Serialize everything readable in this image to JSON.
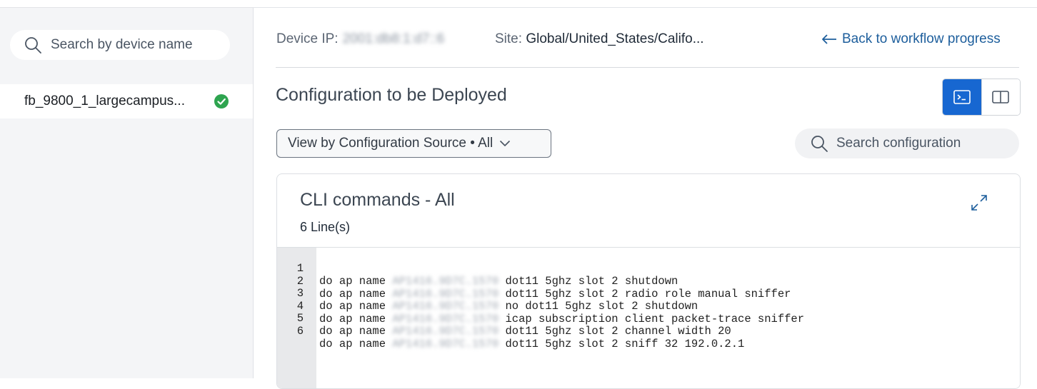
{
  "sidebar": {
    "search_placeholder": "Search by device name",
    "devices": [
      {
        "name": "fb_9800_1_largecampus...",
        "status": "success"
      }
    ]
  },
  "header": {
    "device_ip_label": "Device IP:",
    "device_ip_value": "2001:db8:1:d7::6",
    "site_label": "Site:",
    "site_value": "Global/United_States/Califo...",
    "back_link": "Back to workflow progress"
  },
  "main": {
    "title": "Configuration to be Deployed",
    "filter_label": "View by Configuration Source • All",
    "search_placeholder": "Search configuration",
    "view_toggle": {
      "active": "cli-view",
      "options": [
        "cli-view",
        "split-view"
      ]
    }
  },
  "cli": {
    "title": "CLI commands - All",
    "line_count": "6 Line(s)",
    "lines": [
      {
        "num": "1",
        "prefix": "do ap name",
        "ap": "AP1416.9D7C.1570",
        "cmd": "dot11 5ghz slot 2 shutdown"
      },
      {
        "num": "2",
        "prefix": "do ap name",
        "ap": "AP1416.9D7C.1570",
        "cmd": "dot11 5ghz slot 2 radio role manual sniffer"
      },
      {
        "num": "3",
        "prefix": "do ap name",
        "ap": "AP1416.9D7C.1570",
        "cmd": "no dot11 5ghz slot 2 shutdown"
      },
      {
        "num": "4",
        "prefix": "do ap name",
        "ap": "AP1416.9D7C.1570",
        "cmd": "icap subscription client packet-trace sniffer"
      },
      {
        "num": "5",
        "prefix": "do ap name",
        "ap": "AP1416.9D7C.1570",
        "cmd": "dot11 5ghz slot 2 channel width 20"
      },
      {
        "num": "6",
        "prefix": "do ap name",
        "ap": "AP1416.9D7C.1570",
        "cmd": "dot11 5ghz slot 2 sniff 32 192.0.2.1"
      }
    ]
  },
  "colors": {
    "accent": "#1767d1",
    "link": "#1d5e9c",
    "success": "#2ea44f",
    "sidebar_bg": "#f4f5f7"
  }
}
